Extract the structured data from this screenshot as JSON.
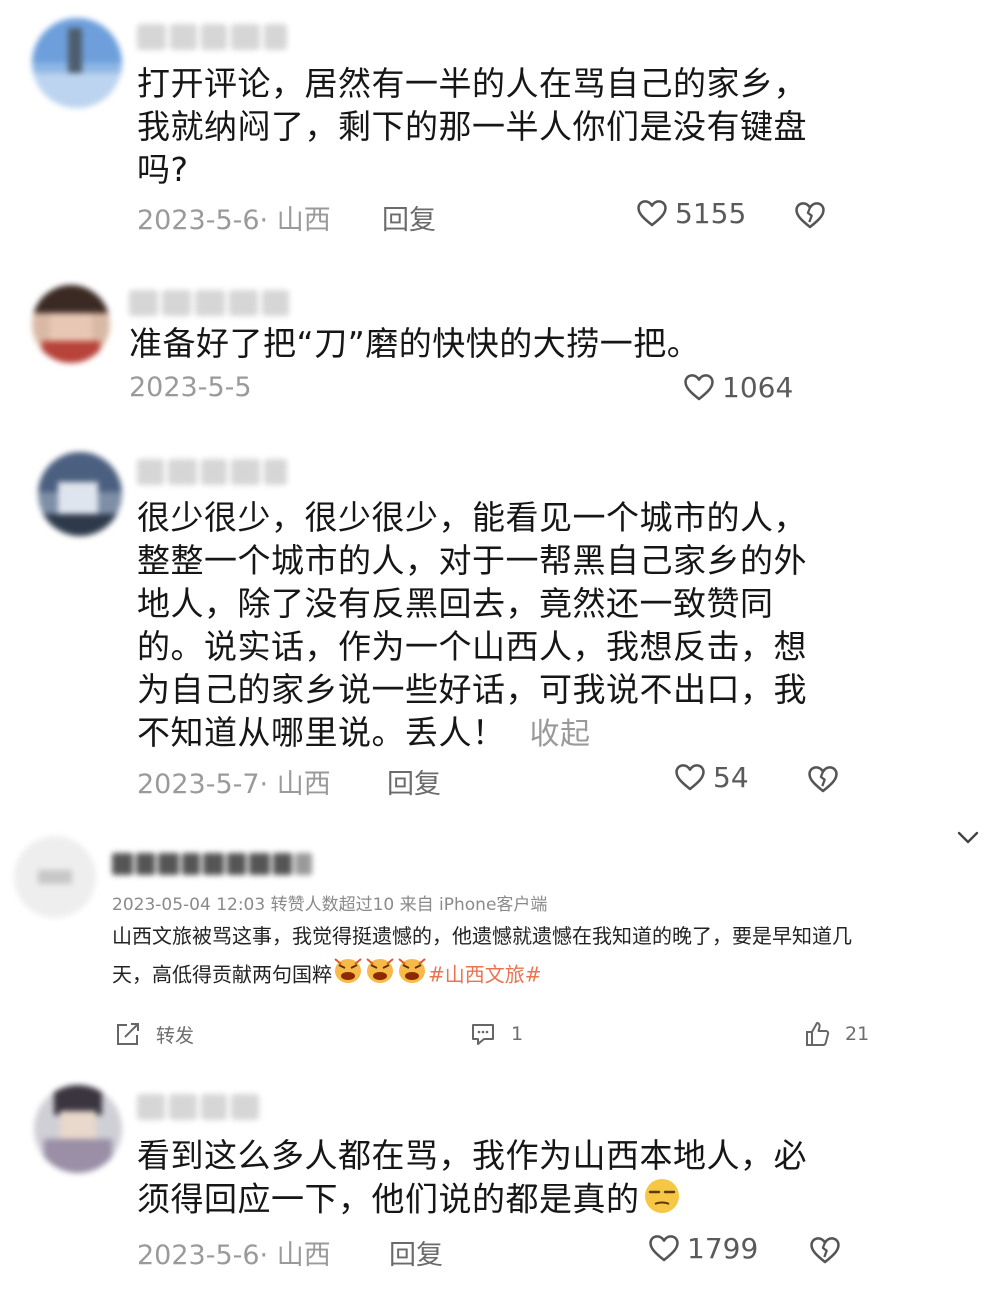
{
  "comments": [
    {
      "lines": [
        "打开评论，居然有一半的人在骂自己的家乡，",
        "我就纳闷了，剩下的那一半人你们是没有键盘",
        "吗?"
      ],
      "meta": "2023-5-6· 山西",
      "reply": "回复",
      "likes": "5155"
    },
    {
      "lines": [
        "准备好了把“刀”磨的快快的大捞一把。"
      ],
      "meta": "2023-5-5",
      "likes": "1064"
    },
    {
      "lines": [
        "很少很少，很少很少，能看见一个城市的人，",
        "整整一个城市的人，对于一帮黑自己家乡的外",
        "地人，除了没有反黑回去，竟然还一致赞同",
        "的。说实话，作为一个山西人，我想反击，想",
        "为自己的家乡说一些好话，可我说不出口，我",
        "不知道从哪里说。丢人！"
      ],
      "collapse": "收起",
      "meta": "2023-5-7· 山西",
      "reply": "回复",
      "likes": "54"
    },
    {
      "lines": [
        "看到这么多人都在骂，我作为山西本地人，必",
        "须得回应一下，他们说的都是真的"
      ],
      "meta": "2023-5-6· 山西",
      "reply": "回复",
      "likes": "1799"
    }
  ],
  "weibo_post": {
    "meta": "2023-05-04 12:03 转赞人数超过10  来自 iPhone客户端",
    "line1": "山西文旅被骂这事，我觉得挺遗憾的，他遗憾就遗憾在我知道的晚了，要是早知道几",
    "line2": "天，高低得贡献两句国粹",
    "hashtag": "#山西文旅#",
    "repost_label": "转发",
    "comment_count": "1",
    "like_count": "21"
  },
  "icons": {
    "heart": "heart-outline-icon",
    "dislike": "broken-heart-icon",
    "chevron": "chevron-down-icon",
    "repost": "repost-icon",
    "comment": "comment-icon",
    "thumb": "thumbs-up-icon",
    "angry": "angry-face-emoji",
    "smug": "smug-face-emoji"
  },
  "colors": {
    "hashtag": "#eb7350",
    "meta": "#9a9a9a"
  }
}
